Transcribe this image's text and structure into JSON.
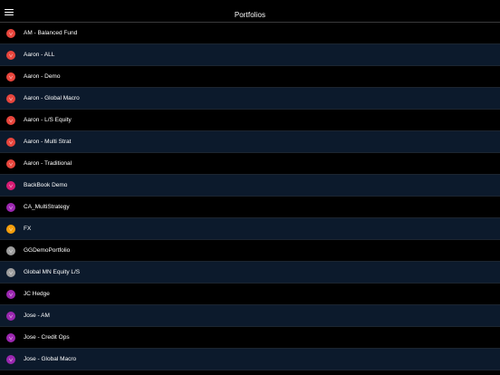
{
  "header": {
    "title": "Portfolios",
    "menu_icon": "hamburger-menu-icon"
  },
  "colors": {
    "background": "#000000",
    "row_alt": "#0c1a2c",
    "red": "#e8453c",
    "pink": "#d81b74",
    "purple": "#9b27b0",
    "orange": "#f59e0b",
    "gray": "#9e9e9e"
  },
  "portfolios": [
    {
      "name": "AM - Balanced Fund",
      "icon": "red-badge-icon",
      "color": "#e8453c"
    },
    {
      "name": "Aaron - ALL",
      "icon": "red-badge-icon",
      "color": "#e8453c"
    },
    {
      "name": "Aaron - Demo",
      "icon": "red-badge-icon",
      "color": "#e8453c"
    },
    {
      "name": "Aaron - Global Macro",
      "icon": "red-badge-icon",
      "color": "#e8453c"
    },
    {
      "name": "Aaron - L/S Equity",
      "icon": "red-badge-icon",
      "color": "#e8453c"
    },
    {
      "name": "Aaron - Multi Strat",
      "icon": "red-badge-icon",
      "color": "#e8453c"
    },
    {
      "name": "Aaron - Traditional",
      "icon": "red-badge-icon",
      "color": "#e8453c"
    },
    {
      "name": "BackBook Demo",
      "icon": "pink-badge-icon",
      "color": "#d81b74"
    },
    {
      "name": "CA_MultiStrategy",
      "icon": "purple-badge-icon",
      "color": "#9b27b0"
    },
    {
      "name": "FX",
      "icon": "orange-badge-icon",
      "color": "#f59e0b"
    },
    {
      "name": "GGDemoPortfolio",
      "icon": "gray-badge-icon",
      "color": "#9e9e9e"
    },
    {
      "name": "Global MN Equity L/S",
      "icon": "gray-badge-icon",
      "color": "#9e9e9e"
    },
    {
      "name": "JC Hedge",
      "icon": "purple-badge-icon",
      "color": "#9b27b0"
    },
    {
      "name": "Jose - AM",
      "icon": "purple-badge-icon",
      "color": "#9b27b0"
    },
    {
      "name": "Jose - Credit Ops",
      "icon": "purple-badge-icon",
      "color": "#9b27b0"
    },
    {
      "name": "Jose - Global Macro",
      "icon": "purple-badge-icon",
      "color": "#9b27b0"
    },
    {
      "name": "",
      "icon": "purple-badge-icon",
      "color": "#9b27b0"
    }
  ]
}
